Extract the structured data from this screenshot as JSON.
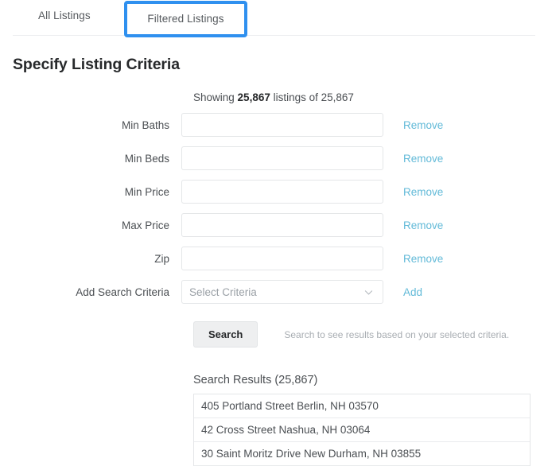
{
  "tabs": [
    {
      "label": "All Listings",
      "selected": false,
      "focused": false
    },
    {
      "label": "Filtered Listings",
      "selected": true,
      "focused": true
    }
  ],
  "page_title": "Specify Listing Criteria",
  "showing": {
    "prefix": "Showing ",
    "count": "25,867",
    "suffix": " listings of 25,867"
  },
  "criteria_rows": [
    {
      "label": "Min Baths",
      "value": "",
      "placeholder": "",
      "action": "Remove"
    },
    {
      "label": "Min Beds",
      "value": "",
      "placeholder": "",
      "action": "Remove"
    },
    {
      "label": "Min Price",
      "value": "",
      "placeholder": "",
      "action": "Remove"
    },
    {
      "label": "Max Price",
      "value": "",
      "placeholder": "",
      "action": "Remove"
    },
    {
      "label": "Zip",
      "value": "",
      "placeholder": "",
      "action": "Remove"
    }
  ],
  "add_criteria_row": {
    "label": "Add Search Criteria",
    "selected_option": "Select Criteria",
    "chevron_icon": "chevron-down-icon",
    "action": "Add"
  },
  "search": {
    "button_label": "Search",
    "hint": "Search to see results based on your selected criteria."
  },
  "results": {
    "title": "Search Results (25,867)",
    "rows": [
      "405 Portland Street Berlin, NH 03570",
      "42 Cross Street Nashua, NH 03064",
      "30 Saint Moritz Drive New Durham, NH 03855"
    ]
  },
  "colors": {
    "focus_blue": "#2f90ef",
    "link_blue": "#62bad8",
    "text": "#4b4f53",
    "border": "#e4e6e8",
    "button_bg": "#eeeff0"
  }
}
